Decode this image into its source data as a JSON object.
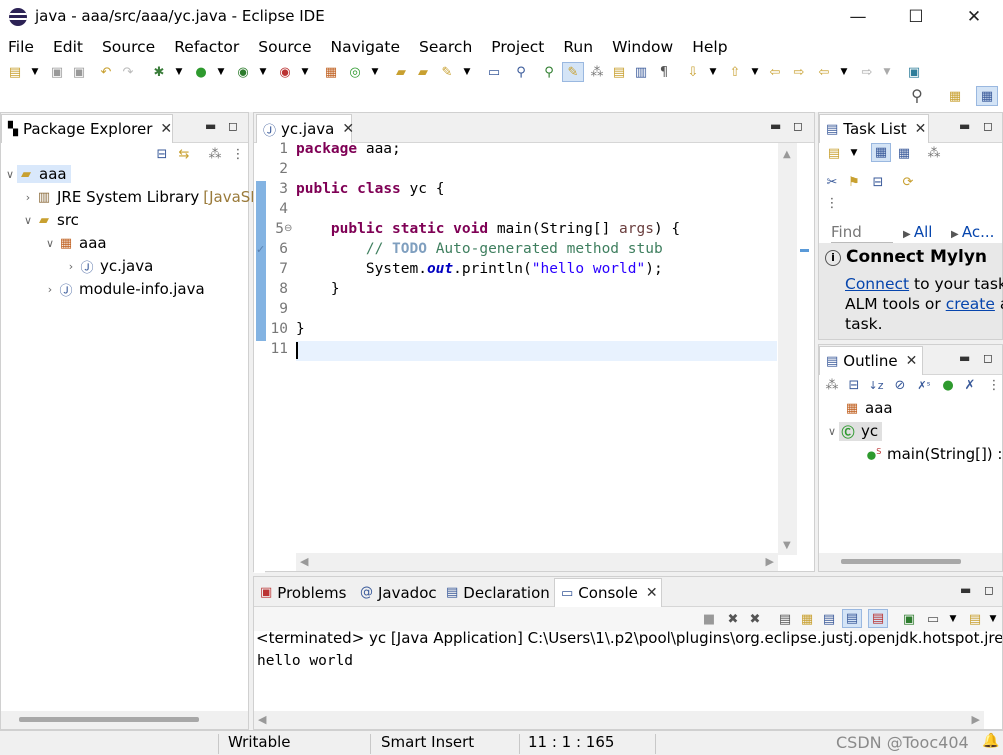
{
  "window": {
    "title": "java - aaa/src/aaa/yc.java - Eclipse IDE",
    "minimize_glyph": "—",
    "maximize_glyph": "☐",
    "close_glyph": "✕"
  },
  "menu": [
    "File",
    "Edit",
    "Source",
    "Refactor",
    "Source",
    "Navigate",
    "Search",
    "Project",
    "Run",
    "Window",
    "Help"
  ],
  "package_explorer": {
    "tab_label": "Package Explorer",
    "tree": [
      {
        "label": "aaa",
        "level": 0,
        "expanded": true,
        "icon": "project-icon"
      },
      {
        "label": "JRE System Library",
        "suffix": "[JavaSE",
        "level": 1,
        "expanded": false,
        "icon": "library-icon"
      },
      {
        "label": "src",
        "level": 1,
        "expanded": true,
        "icon": "source-folder-icon"
      },
      {
        "label": "aaa",
        "level": 2,
        "expanded": true,
        "icon": "package-icon"
      },
      {
        "label": "yc.java",
        "level": 3,
        "expanded": false,
        "icon": "java-file-icon"
      },
      {
        "label": "module-info.java",
        "level": 2,
        "expanded": false,
        "icon": "java-file-icon"
      }
    ]
  },
  "editor": {
    "tab_label": "yc.java",
    "line_numbers": [
      "1",
      "2",
      "3",
      "4",
      "5",
      "6",
      "7",
      "8",
      "9",
      "10",
      "11"
    ]
  },
  "task_list": {
    "tab_label": "Task List",
    "find_placeholder": "Find",
    "filter_all": "All",
    "filter_activate": "Ac...",
    "mylyn_title": "Connect Mylyn",
    "mylyn_connect": "Connect",
    "mylyn_text1": " to your task a",
    "mylyn_text2": "ALM tools or ",
    "mylyn_create": "create",
    "mylyn_text3": " a",
    "mylyn_text4": "task."
  },
  "outline": {
    "tab_label": "Outline",
    "items": [
      {
        "label": "aaa",
        "icon": "package-icon"
      },
      {
        "label": "yc",
        "icon": "class-icon"
      },
      {
        "label": "main(String[]) : v",
        "icon": "method-icon"
      }
    ]
  },
  "bottom_tabs": [
    {
      "label": "Problems",
      "icon": "problems-icon"
    },
    {
      "label": "Javadoc",
      "icon": "javadoc-icon"
    },
    {
      "label": "Declaration",
      "icon": "declaration-icon"
    },
    {
      "label": "Console",
      "icon": "console-icon"
    }
  ],
  "console": {
    "header": "<terminated> yc [Java Application] C:\\Users\\1\\.p2\\pool\\plugins\\org.eclipse.justj.openjdk.hotspot.jre.fu",
    "output": "hello world"
  },
  "status": {
    "writable": "Writable",
    "insert_mode": "Smart Insert",
    "position": "11 : 1 : 165"
  },
  "watermark": "CSDN @Tooc404"
}
